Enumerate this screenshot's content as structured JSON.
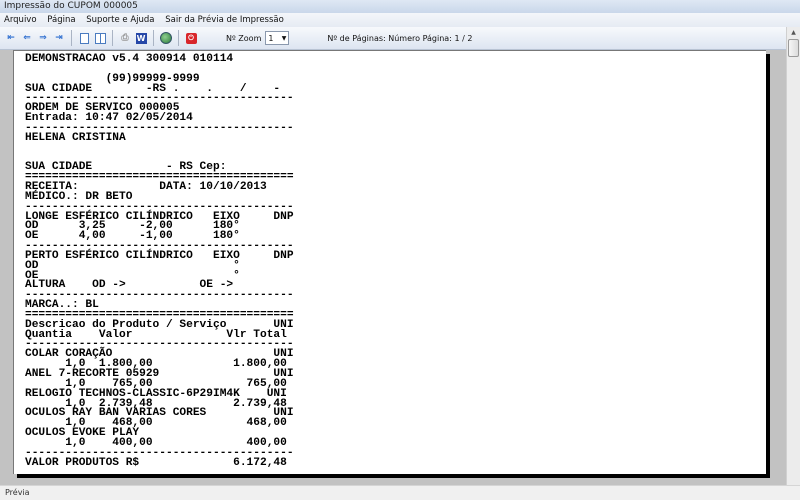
{
  "window": {
    "title": "Impressão do CUPOM 000005"
  },
  "menu": [
    "Arquivo",
    "Página",
    "Suporte e Ajuda",
    "Sair da Prévia de Impressão"
  ],
  "toolbar": {
    "zoom_label": "Nº Zoom",
    "zoom_value": "1",
    "pages_label": "Nº de Páginas: Número Página: 1 / 2"
  },
  "status": {
    "text": "Prévia"
  },
  "receipt": {
    "lines": [
      "DEMONSTRACAO v5.4 300914 010114",
      "",
      "            (99)99999-9999",
      "SUA CIDADE        -RS .    .    /    -",
      "----------------------------------------",
      "ORDEM DE SERVICO 000005",
      "Entrada: 10:47 02/05/2014",
      "----------------------------------------",
      "HELENA CRISTINA",
      "",
      "",
      "SUA CIDADE           - RS Cep:",
      "========================================",
      "RECEITA:            DATA: 10/10/2013",
      "MÉDICO.: DR BETO",
      "----------------------------------------",
      "LONGE ESFÉRICO CILÍNDRICO   EIXO     DNP",
      "OD      3,25     -2,00      180°",
      "OE      4,00     -1,00      180°",
      "----------------------------------------",
      "PERTO ESFÉRICO CILÍNDRICO   EIXO     DNP",
      "OD                             °",
      "OE                             °",
      "ALTURA    OD ->           OE ->",
      "----------------------------------------",
      "MARCA..: BL",
      "========================================",
      "Descricao do Produto / Serviço       UNI",
      "Quantia    Valor              Vlr Total",
      "----------------------------------------",
      "COLAR CORAÇÃO                        UNI",
      "      1,0  1.800,00            1.800,00",
      "ANEL 7-RECORTE 05929                 UNI",
      "      1,0    765,00              765,00",
      "RELOGIO TECHNOS-CLASSIC-6P29IM4K    UNI",
      "      1,0  2.739,48            2.739,48",
      "OCULOS RAY BAN VARIAS CORES          UNI",
      "      1,0    468,00              468,00",
      "OCULOS EVOKE PLAY",
      "      1,0    400,00              400,00",
      "----------------------------------------",
      "VALOR PRODUTOS R$              6.172,48"
    ]
  }
}
